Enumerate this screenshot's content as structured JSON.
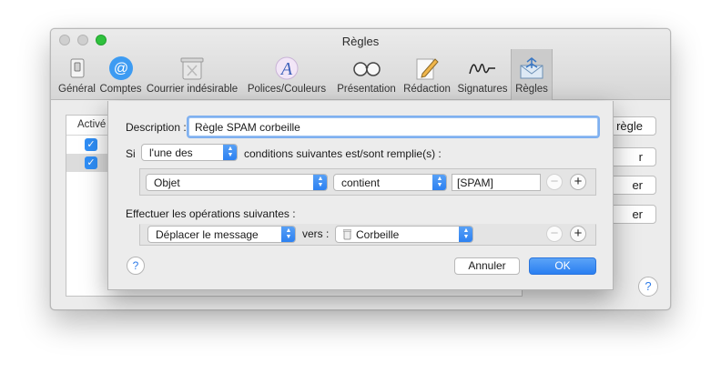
{
  "window": {
    "title": "Règles"
  },
  "toolbar": {
    "items": [
      {
        "label": "Général",
        "icon": "switch-icon"
      },
      {
        "label": "Comptes",
        "icon": "at-sign-icon"
      },
      {
        "label": "Courrier indésirable",
        "icon": "trash-icon"
      },
      {
        "label": "Polices/Couleurs",
        "icon": "fonts-colors-icon"
      },
      {
        "label": "Présentation",
        "icon": "glasses-icon"
      },
      {
        "label": "Rédaction",
        "icon": "pencil-icon"
      },
      {
        "label": "Signatures",
        "icon": "signature-icon"
      },
      {
        "label": "Règles",
        "icon": "envelope-rules-icon",
        "active": true
      }
    ]
  },
  "rules": {
    "column_header": "Activé",
    "rows": [
      {
        "checked": true
      },
      {
        "checked": true,
        "selected": true
      }
    ],
    "side_buttons": [
      "règle",
      "r",
      "er",
      "er"
    ]
  },
  "sheet": {
    "description_label": "Description :",
    "description_value": "Règle SPAM corbeille",
    "if_label": "Si",
    "match_select": "l'une des",
    "conditions_text": "conditions suivantes est/sont remplie(s) :",
    "condition": {
      "field": "Objet",
      "operator": "contient",
      "value": "[SPAM]"
    },
    "actions_label": "Effectuer les opérations suivantes :",
    "action": {
      "operation": "Déplacer le message",
      "to_label": "vers :",
      "mailbox": "Corbeille"
    },
    "help_symbol": "?",
    "cancel_label": "Annuler",
    "ok_label": "OK",
    "plus_symbol": "+",
    "minus_symbol": "−"
  },
  "colors": {
    "accent": "#2a7ff1",
    "focus_ring": "#7fb0f0",
    "window_bg": "#ececec"
  }
}
